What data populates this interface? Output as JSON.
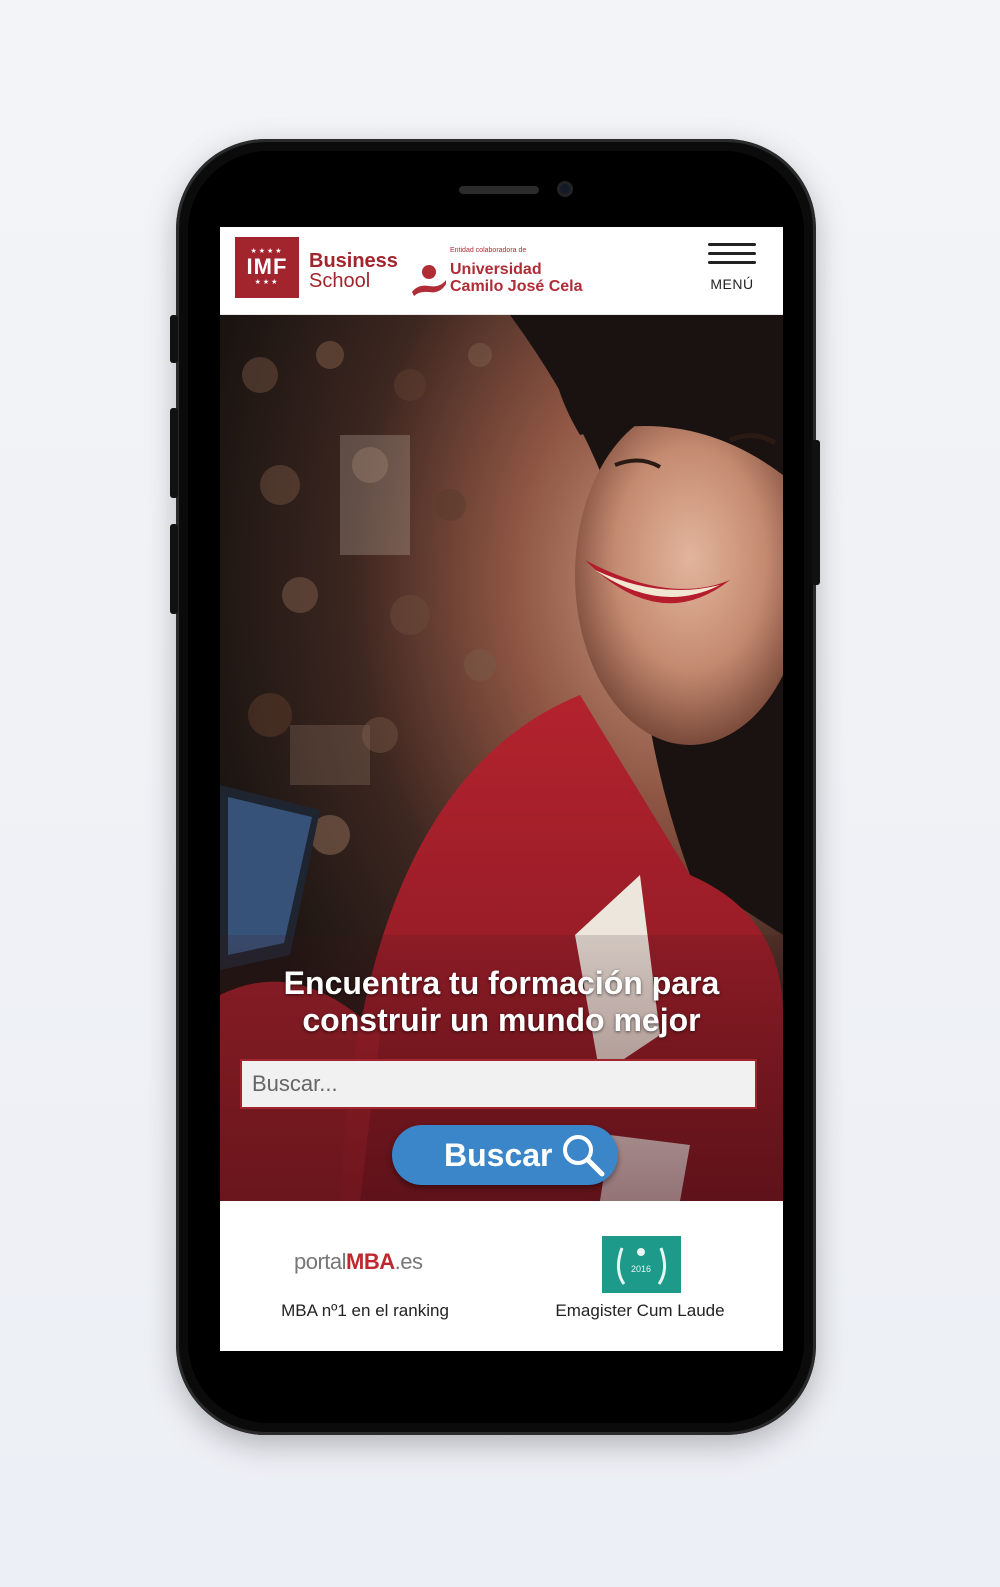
{
  "header": {
    "logo_imf": "IMF",
    "logo_business": "Business",
    "logo_school": "School",
    "partner_small": "Entidad colaboradora de",
    "partner_line1": "Universidad",
    "partner_line2": "Camilo José Cela",
    "menu_label": "MENÚ"
  },
  "hero": {
    "title": "Encuentra tu formación para construir un mundo mejor",
    "search_placeholder": "Buscar...",
    "search_button": "Buscar"
  },
  "badges": {
    "portal_prefix": "portal",
    "portal_mba": "MBA",
    "portal_suffix": ".es",
    "portal_caption": "MBA nº1 en el ranking",
    "emag_year": "2016",
    "emag_caption": "Emagister Cum Laude"
  },
  "colors": {
    "brand": "#a2242d",
    "button": "#3a86c8",
    "emagister": "#1e9a8a"
  },
  "icons": [
    "hamburger-icon",
    "search-icon",
    "laurel-icon",
    "person-icon"
  ]
}
